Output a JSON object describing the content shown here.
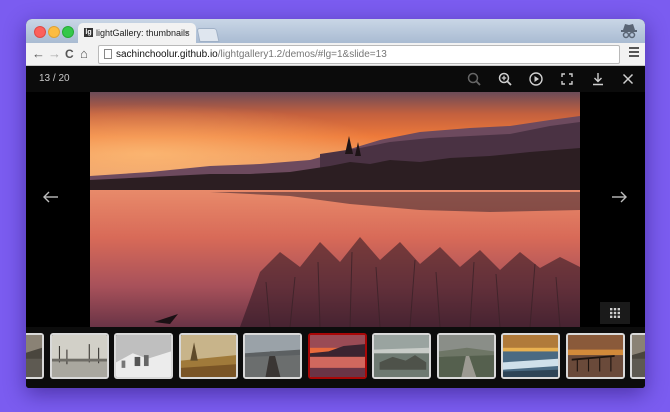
{
  "browser": {
    "tab_title": "lightGallery: thumbnails",
    "tab_favicon": "lightgallery-favicon",
    "tab_close": "×",
    "url_host": "sachinchoolur.github.io",
    "url_path": "/lightgallery1.2/demos/#lg=1&slide=13",
    "back_icon": "←",
    "forward_icon": "→",
    "reload_icon": "C",
    "home_icon": "⌂"
  },
  "gallery": {
    "counter": "13 / 20",
    "current_slide": 13,
    "total_slides": 20,
    "toolbar_icons": [
      "zoom-out-icon",
      "zoom-in-icon",
      "autoplay-icon",
      "fullscreen-icon",
      "download-icon",
      "close-icon"
    ],
    "nav_icons": [
      "prev-arrow-icon",
      "next-arrow-icon"
    ],
    "accent_color": "#a90707"
  },
  "thumbnails": [
    {
      "theme": "lakeside-partial",
      "active": false
    },
    {
      "theme": "misty-lake-trees",
      "active": false
    },
    {
      "theme": "snowy-hills",
      "active": false
    },
    {
      "theme": "autumn-field",
      "active": false
    },
    {
      "theme": "boardwalk",
      "active": false
    },
    {
      "theme": "sunset-lake",
      "active": true
    },
    {
      "theme": "rocky-coast",
      "active": false
    },
    {
      "theme": "country-road",
      "active": false
    },
    {
      "theme": "golden-beach",
      "active": false
    },
    {
      "theme": "pier-sunset",
      "active": false
    },
    {
      "theme": "lakeside-partial",
      "active": false
    }
  ]
}
